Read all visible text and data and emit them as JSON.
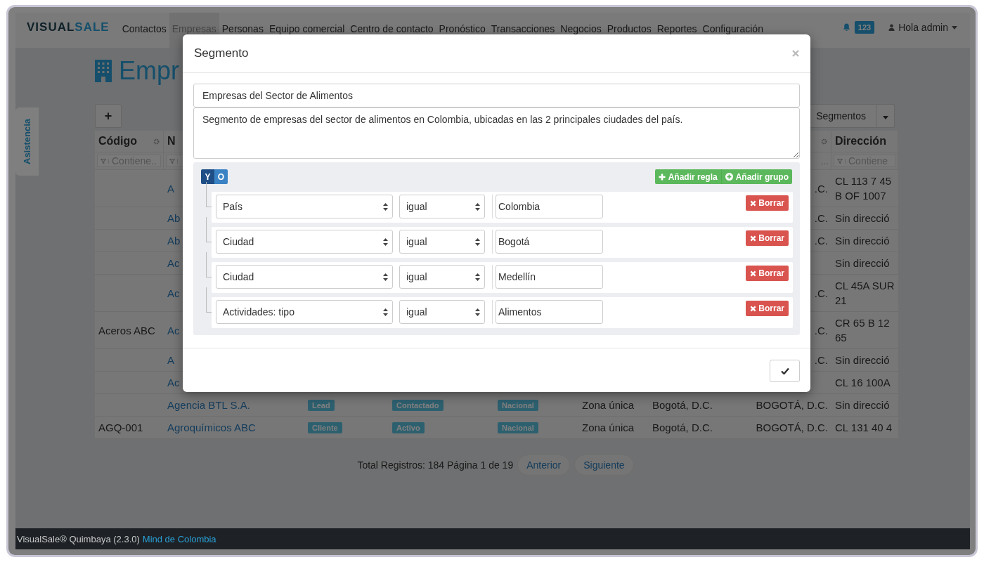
{
  "navbar": {
    "brand": {
      "part_1": "VISUAL",
      "part_2": "SALE"
    },
    "items": [
      {
        "label": "Contactos",
        "selected": false
      },
      {
        "label": "Empresas",
        "selected": true
      },
      {
        "label": "Personas",
        "selected": false
      },
      {
        "label": "Equipo comercial",
        "selected": false
      },
      {
        "label": "Centro de contacto",
        "selected": false
      },
      {
        "label": "Pronóstico",
        "selected": false
      },
      {
        "label": "Transacciones",
        "selected": false
      },
      {
        "label": "Negocios",
        "selected": false
      },
      {
        "label": "Productos",
        "selected": false
      },
      {
        "label": "Reportes",
        "selected": false
      },
      {
        "label": "Configuración",
        "selected": false
      }
    ],
    "notifications": "123",
    "user": "Hola admin"
  },
  "sidebar_tab": "Asistencia",
  "page_title": "Empr",
  "toolbar": {
    "add": "+",
    "segments": "Segmentos"
  },
  "table": {
    "header": {
      "code": "Código",
      "code_filter": "Contiene..",
      "name": "N",
      "column_8_filter": "...",
      "address": "Dirección",
      "address_filter": "Contiene"
    },
    "rows": [
      {
        "name": "A",
        "state": ".C.",
        "address": "CL 113 7 45\nB OF 1007"
      },
      {
        "name": "Ab",
        "state": ".C.",
        "address": "Sin direcció"
      },
      {
        "name": "Ab",
        "state": ".C.",
        "address": "Sin direcció"
      },
      {
        "name": "Ac",
        "address": "Sin direcció"
      },
      {
        "name": "Ac",
        "state": ".C.",
        "address": "CL 45A SUR\n21"
      },
      {
        "code": "Aceros ABC",
        "name": "Ac",
        "state": ".C.",
        "address": "CR 65 B 12\n65"
      },
      {
        "name": "A",
        "state": ".C.",
        "address": "Sin direcció"
      },
      {
        "name": "Ac",
        "address": "CL 16 100A"
      },
      {
        "name": "Agencia BTL S.A.",
        "type": "Lead",
        "status": "Contactado",
        "scope": "Nacional",
        "zone": "Zona única",
        "city": "Bogotá, D.C.",
        "state": "BOGOTÁ, D.C.",
        "address": "Sin direcció"
      },
      {
        "code": "AGQ-001",
        "name": "Agroquímicos ABC",
        "type": "Cliente",
        "status": "Activo",
        "scope": "Nacional",
        "zone": "Zona única",
        "city": "Bogotá, D.C.",
        "state": "BOGOTÁ, D.C.",
        "address": "CL 131 40 4"
      }
    ]
  },
  "pagination": {
    "summary": "Total Registros: 184 Página 1 de 19",
    "buttons": [
      "Anterior",
      "Siguiente"
    ]
  },
  "footer": {
    "product": "VisualSale® Quimbaya (2.3.0)",
    "link": "Mind de Colombia"
  },
  "modal": {
    "title": "Segmento",
    "name_value": "Empresas del Sector de Alimentos",
    "description_value": "Segmento de empresas del sector de alimentos en Colombia, ubicadas en las 2 principales ciudades del país.",
    "conditions": [
      {
        "label": "Y",
        "selected": true
      },
      {
        "label": "O",
        "selected": false
      }
    ],
    "add_rule": "Añadir regla",
    "add_group": "Añadir grupo",
    "rules": [
      {
        "field": "País",
        "operator": "igual",
        "value": "Colombia",
        "delete": "Borrar"
      },
      {
        "field": "Ciudad",
        "operator": "igual",
        "value": "Bogotá",
        "delete": "Borrar"
      },
      {
        "field": "Ciudad",
        "operator": "igual",
        "value": "Medellín",
        "delete": "Borrar"
      },
      {
        "field": "Actividades: tipo",
        "operator": "igual",
        "value": "Alimentos",
        "delete": "Borrar"
      }
    ]
  }
}
